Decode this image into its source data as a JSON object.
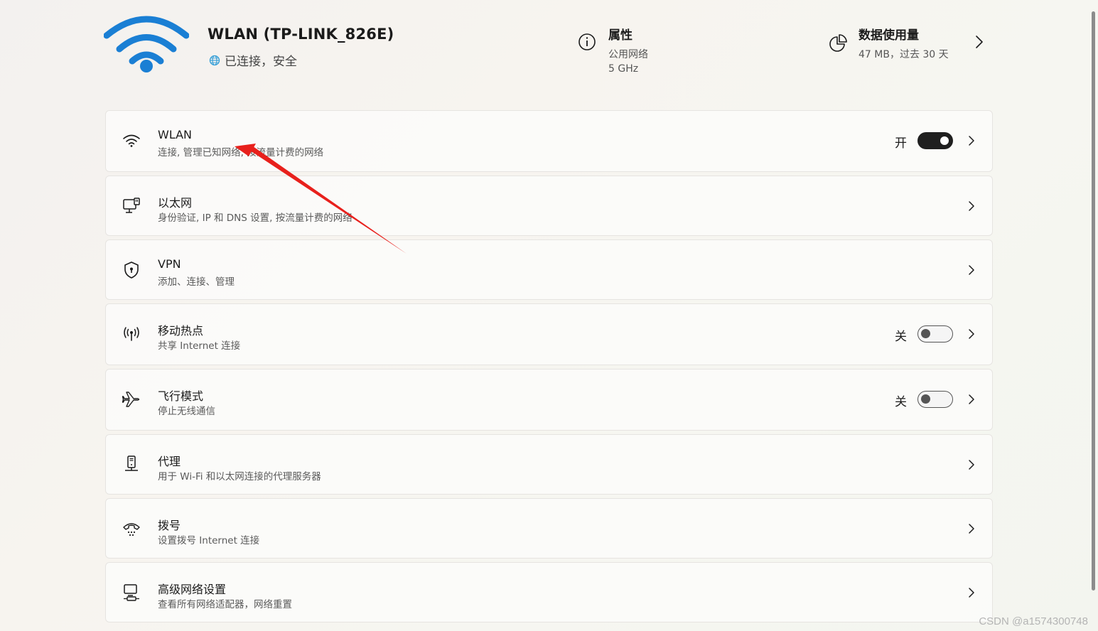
{
  "header": {
    "network_name": "WLAN (TP-LINK_826E)",
    "status": "已连接，安全",
    "properties": {
      "title": "属性",
      "line1": "公用网络",
      "line2": "5 GHz"
    },
    "usage": {
      "title": "数据使用量",
      "detail": "47 MB，过去 30 天"
    }
  },
  "rows": [
    {
      "title": "WLAN",
      "subtitle": "连接, 管理已知网络, 按流量计费的网络",
      "toggle_label": "开",
      "toggle": "on",
      "icon": "wifi-icon"
    },
    {
      "title": "以太网",
      "subtitle": "身份验证, IP 和 DNS 设置, 按流量计费的网络",
      "icon": "ethernet-icon"
    },
    {
      "title": "VPN",
      "subtitle": "添加、连接、管理",
      "icon": "shield-icon"
    },
    {
      "title": "移动热点",
      "subtitle": "共享 Internet 连接",
      "toggle_label": "关",
      "toggle": "off",
      "icon": "hotspot-icon"
    },
    {
      "title": "飞行模式",
      "subtitle": "停止无线通信",
      "toggle_label": "关",
      "toggle": "off",
      "icon": "airplane-icon"
    },
    {
      "title": "代理",
      "subtitle": "用于 Wi-Fi 和以太网连接的代理服务器",
      "icon": "proxy-icon"
    },
    {
      "title": "拨号",
      "subtitle": "设置拨号 Internet 连接",
      "icon": "dialup-icon"
    },
    {
      "title": "高级网络设置",
      "subtitle": "查看所有网络适配器，网络重置",
      "icon": "advanced-network-icon"
    }
  ],
  "colors": {
    "wifi_blue": "#1a7fd4",
    "annotation_red": "#e8201c"
  },
  "watermark": "CSDN @a1574300748"
}
